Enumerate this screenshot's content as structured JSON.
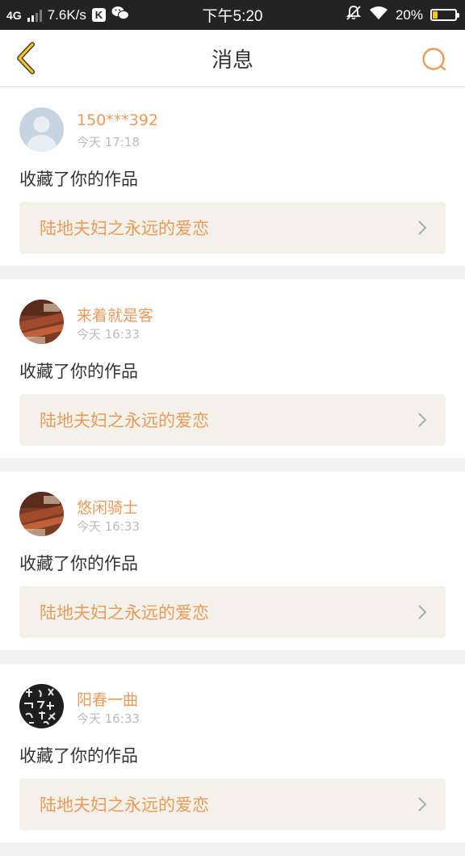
{
  "status_bar": {
    "network": "4G",
    "speed": "7.6K/s",
    "k_icon": "K",
    "time": "下午5:20",
    "battery": "20%",
    "battery_level": 0.2,
    "icons": [
      "signal-icon",
      "k-app-icon",
      "wechat-icon",
      "alarm-off-icon",
      "wifi-icon",
      "battery-icon"
    ]
  },
  "nav": {
    "title": "消息",
    "icons": [
      "back-arrow-icon",
      "search-icon"
    ]
  },
  "colors": {
    "accent": "#ec9a5a",
    "back_arrow": "#f5c61e",
    "card_link_bg": "#f2f2ea",
    "page_bg": "#f2f2f2"
  },
  "messages": [
    {
      "username": "150***392",
      "time": "今天 17:18",
      "action": "收藏了你的作品",
      "work_title": "陆地夫妇之永远的爱恋",
      "avatar": "default-avatar"
    },
    {
      "username": "来着就是客",
      "time": "今天 16:33",
      "action": "收藏了你的作品",
      "work_title": "陆地夫妇之永远的爱恋",
      "avatar": "library-photo-avatar"
    },
    {
      "username": "悠闲骑士",
      "time": "今天 16:33",
      "action": "收藏了你的作品",
      "work_title": "陆地夫妇之永远的爱恋",
      "avatar": "library-photo-avatar"
    },
    {
      "username": "阳春一曲",
      "time": "今天 16:33",
      "action": "收藏了你的作品",
      "work_title": "陆地夫妇之永远的爱恋",
      "avatar": "calligraphy-avatar"
    }
  ]
}
